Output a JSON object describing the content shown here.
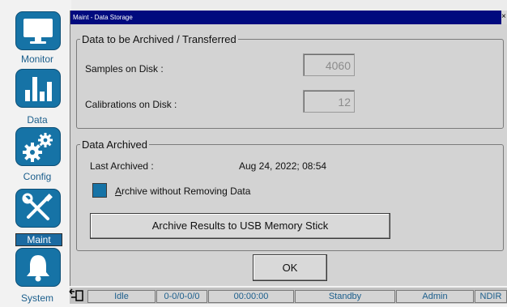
{
  "nav": {
    "items": [
      {
        "label": "Monitor",
        "icon": "monitor-icon",
        "active": false
      },
      {
        "label": "Data",
        "icon": "bar-chart-icon",
        "active": false
      },
      {
        "label": "Config",
        "icon": "gears-icon",
        "active": false
      },
      {
        "label": "Maint",
        "icon": "tools-icon",
        "active": true
      },
      {
        "label": "System",
        "icon": "bell-icon",
        "active": false
      }
    ]
  },
  "window": {
    "title": "Maint - Data Storage",
    "close_label": "×"
  },
  "archive_group": {
    "legend": "Data to be Archived / Transferred",
    "samples_label": "Samples on Disk :",
    "samples_value": "4060",
    "calibrations_label": "Calibrations on Disk :",
    "calibrations_value": "12"
  },
  "archived_group": {
    "legend": "Data Archived",
    "last_archived_label": "Last Archived :",
    "last_archived_value": "Aug 24, 2022; 08:54",
    "checkbox_label_accel": "A",
    "checkbox_label_rest": "rchive without Removing Data",
    "archive_button": "Archive Results to USB Memory Stick"
  },
  "ok_button": "OK",
  "status_bar": {
    "status": "Idle",
    "counter": "0-0/0-0/0",
    "time": "00:00:00",
    "mode": "Standby",
    "user": "Admin",
    "detector": "NDIR"
  },
  "colors": {
    "accent": "#1673a6",
    "titlebar": "#000a7e",
    "panel": "#d3d3d3"
  }
}
